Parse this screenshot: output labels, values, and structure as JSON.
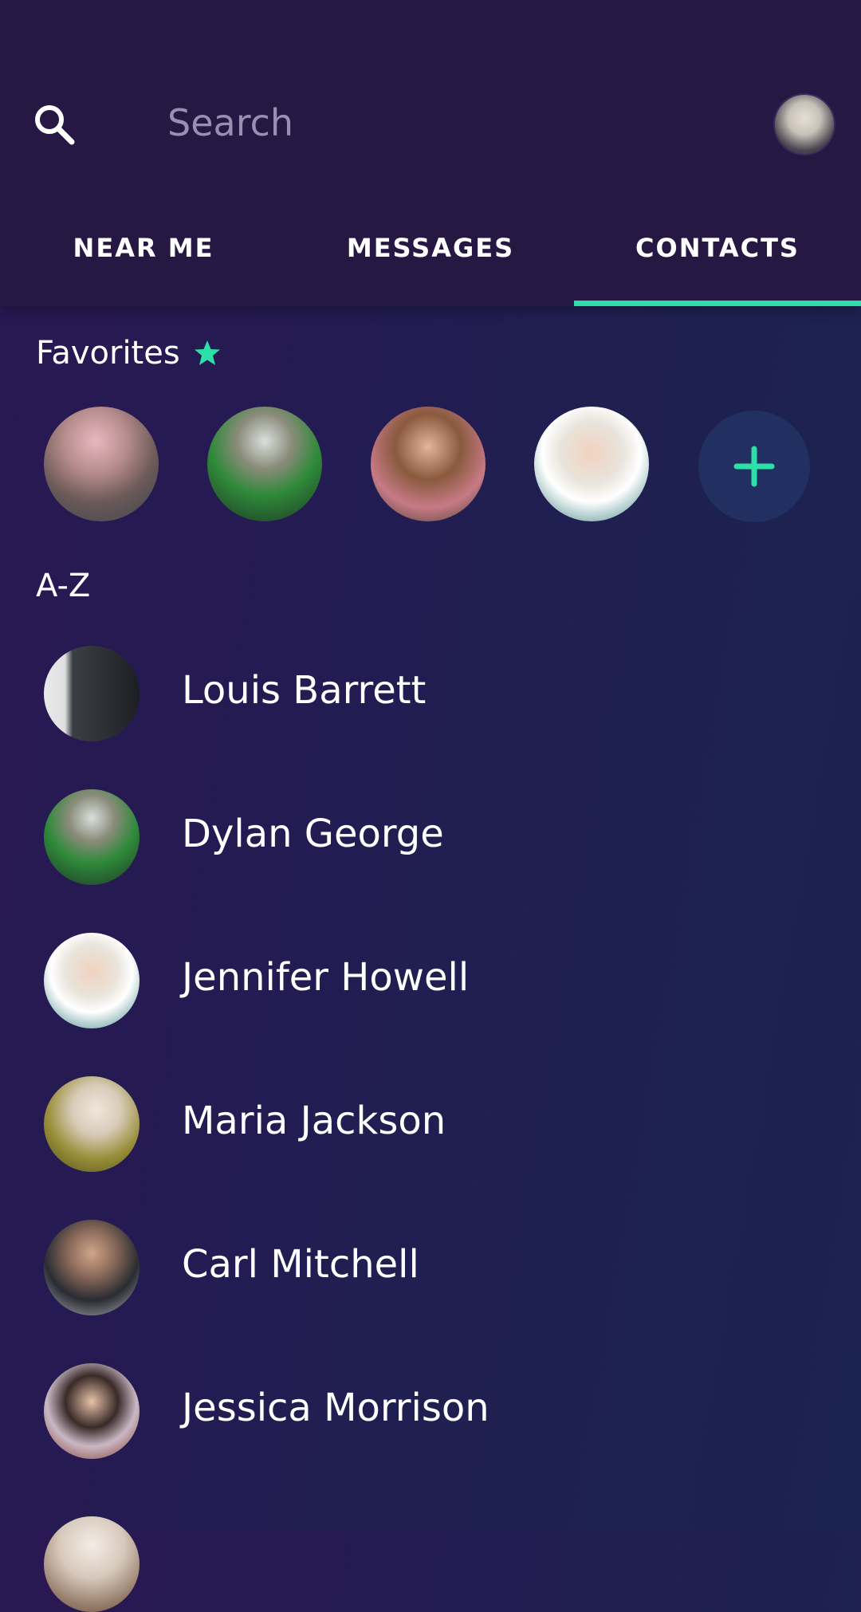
{
  "search": {
    "placeholder": "Search"
  },
  "tabs": [
    {
      "label": "NEAR ME",
      "active": false
    },
    {
      "label": "MESSAGES",
      "active": false
    },
    {
      "label": "CONTACTS",
      "active": true
    }
  ],
  "favorites": {
    "title": "Favorites",
    "icon": "star-icon",
    "count": 4
  },
  "az_section": {
    "title": "A-Z"
  },
  "contacts": [
    {
      "name": "Louis Barrett"
    },
    {
      "name": "Dylan George"
    },
    {
      "name": "Jennifer Howell"
    },
    {
      "name": "Maria Jackson"
    },
    {
      "name": "Carl Mitchell"
    },
    {
      "name": "Jessica Morrison"
    }
  ],
  "colors": {
    "accent": "#2de0a8",
    "header_bg": "#261743",
    "add_button_bg": "#213060"
  }
}
